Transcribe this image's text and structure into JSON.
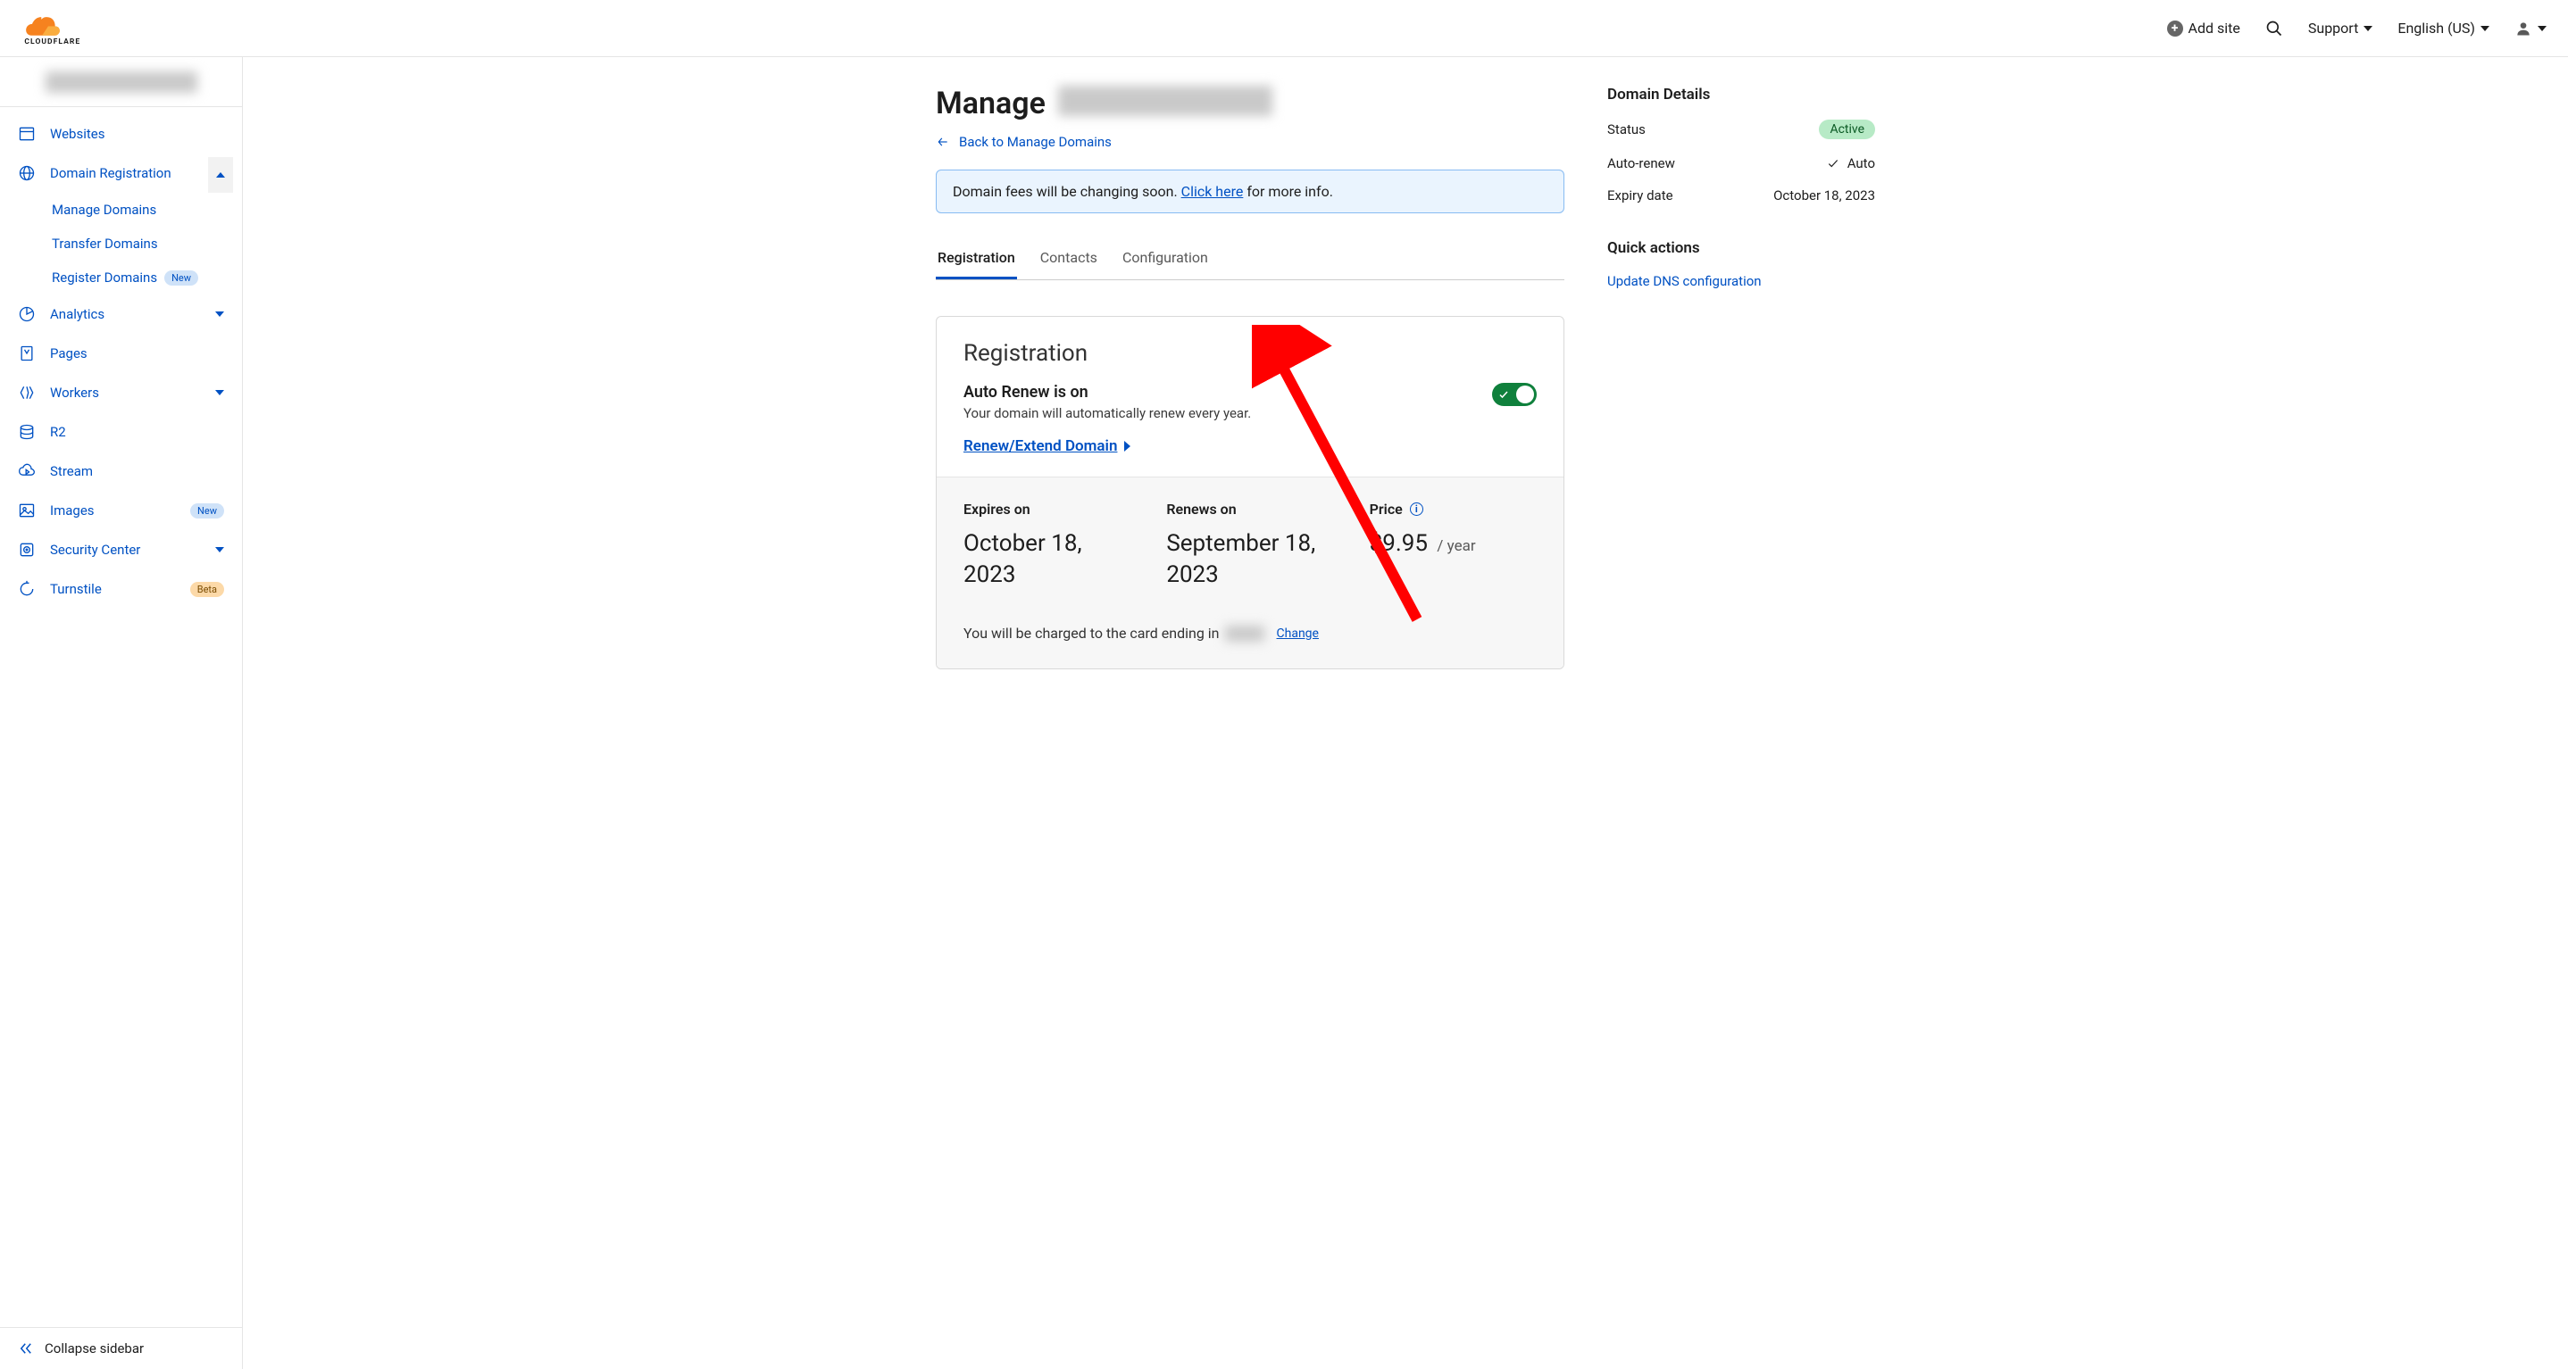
{
  "header": {
    "add_site": "Add site",
    "support": "Support",
    "language": "English (US)"
  },
  "sidebar": {
    "items": {
      "websites": "Websites",
      "domain_registration": "Domain Registration",
      "manage_domains": "Manage Domains",
      "transfer_domains": "Transfer Domains",
      "register_domains": "Register Domains",
      "analytics": "Analytics",
      "pages": "Pages",
      "workers": "Workers",
      "r2": "R2",
      "stream": "Stream",
      "images": "Images",
      "security_center": "Security Center",
      "turnstile": "Turnstile"
    },
    "badges": {
      "new": "New",
      "beta": "Beta"
    },
    "collapse": "Collapse sidebar"
  },
  "page": {
    "title_prefix": "Manage",
    "back": "Back to Manage Domains",
    "notice_pre": "Domain fees will be changing soon. ",
    "notice_link": "Click here",
    "notice_post": " for more info."
  },
  "tabs": {
    "registration": "Registration",
    "contacts": "Contacts",
    "configuration": "Configuration"
  },
  "registration": {
    "heading": "Registration",
    "autorenew_title": "Auto Renew is on",
    "autorenew_desc": "Your domain will automatically renew every year.",
    "renew_link": "Renew/Extend Domain",
    "expires_label": "Expires on",
    "expires_value": "October 18, 2023",
    "renews_label": "Renews on",
    "renews_value": "September 18, 2023",
    "price_label": "Price",
    "price_value": "$9.95",
    "price_unit": "/ year",
    "charge_pre": "You will be charged to the card ending in",
    "change": "Change"
  },
  "details": {
    "heading": "Domain Details",
    "status_label": "Status",
    "status_value": "Active",
    "autorenew_label": "Auto-renew",
    "autorenew_value": "Auto",
    "expiry_label": "Expiry date",
    "expiry_value": "October 18, 2023"
  },
  "quick_actions": {
    "heading": "Quick actions",
    "update_dns": "Update DNS configuration"
  }
}
